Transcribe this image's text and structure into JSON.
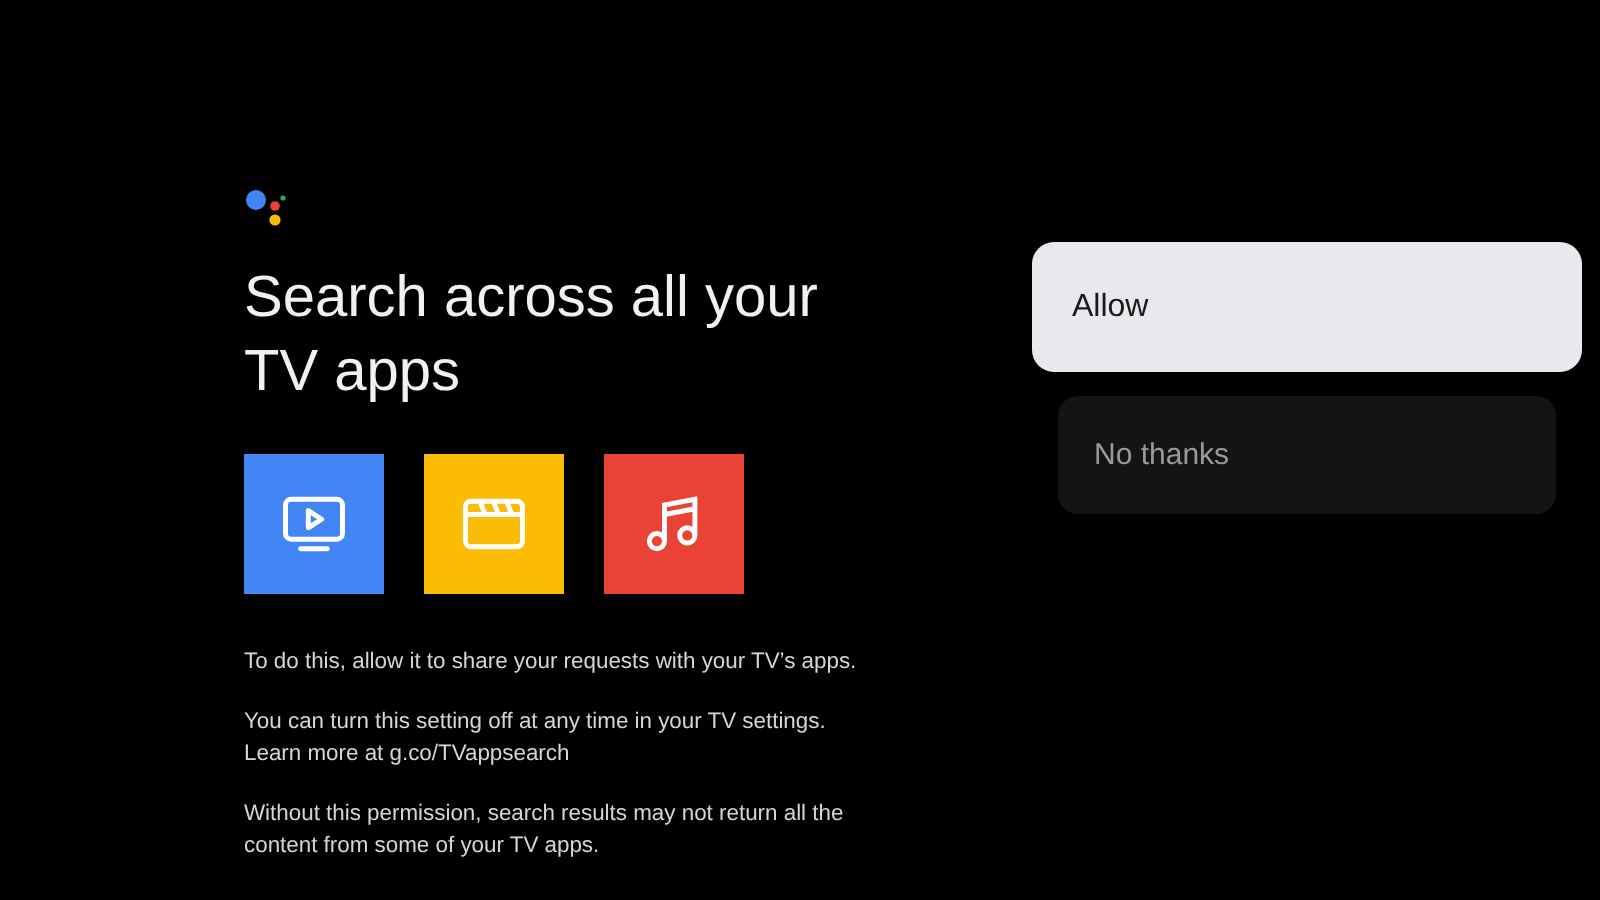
{
  "title": "Search across all your TV apps",
  "app_tiles": [
    {
      "kind": "tv",
      "color": "#4285f4"
    },
    {
      "kind": "clapper",
      "color": "#fbbc04"
    },
    {
      "kind": "music",
      "color": "#ea4335"
    }
  ],
  "paragraphs": [
    [
      "To do this, allow it to share your requests with your TV’s apps."
    ],
    [
      "You can turn this setting off at any time in your TV settings.",
      "Learn more at g.co/TVappsearch"
    ],
    [
      "Without this permission, search results may not return all the",
      "content from some of your TV apps."
    ]
  ],
  "buttons": [
    {
      "label": "Allow",
      "selected": true
    },
    {
      "label": "No thanks",
      "selected": false
    }
  ]
}
